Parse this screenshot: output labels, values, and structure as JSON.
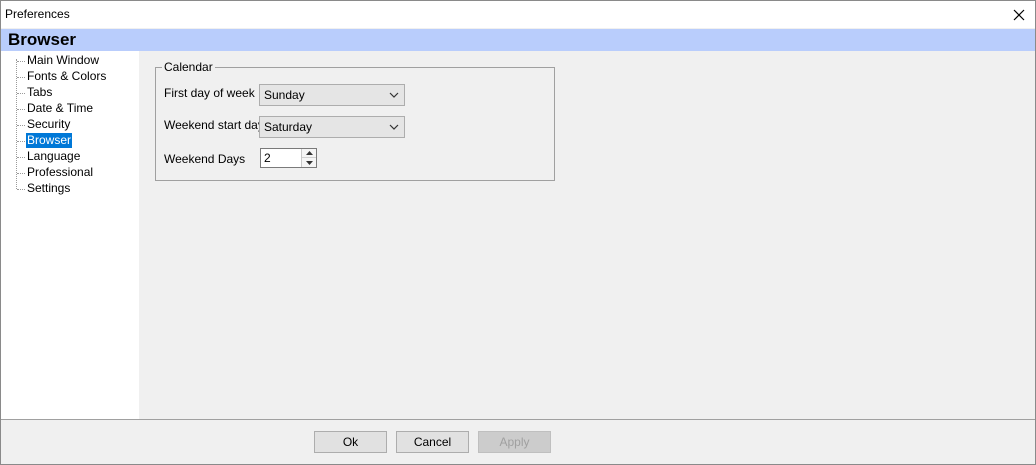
{
  "window": {
    "title": "Preferences"
  },
  "header": {
    "title": "Browser"
  },
  "sidebar": {
    "items": [
      {
        "label": "Main Window"
      },
      {
        "label": "Fonts & Colors"
      },
      {
        "label": "Tabs"
      },
      {
        "label": "Date & Time"
      },
      {
        "label": "Security"
      },
      {
        "label": "Browser",
        "selected": true
      },
      {
        "label": "Language"
      },
      {
        "label": "Professional"
      },
      {
        "label": "Settings"
      }
    ]
  },
  "calendar": {
    "group_label": "Calendar",
    "first_day_label": "First day of week",
    "first_day_value": "Sunday",
    "weekend_start_label": "Weekend start day",
    "weekend_start_value": "Saturday",
    "weekend_days_label": "Weekend Days",
    "weekend_days_value": "2"
  },
  "footer": {
    "ok_label": "Ok",
    "cancel_label": "Cancel",
    "apply_label": "Apply"
  },
  "colors": {
    "header_bg": "#b9cdfc",
    "selection": "#0078d7"
  }
}
